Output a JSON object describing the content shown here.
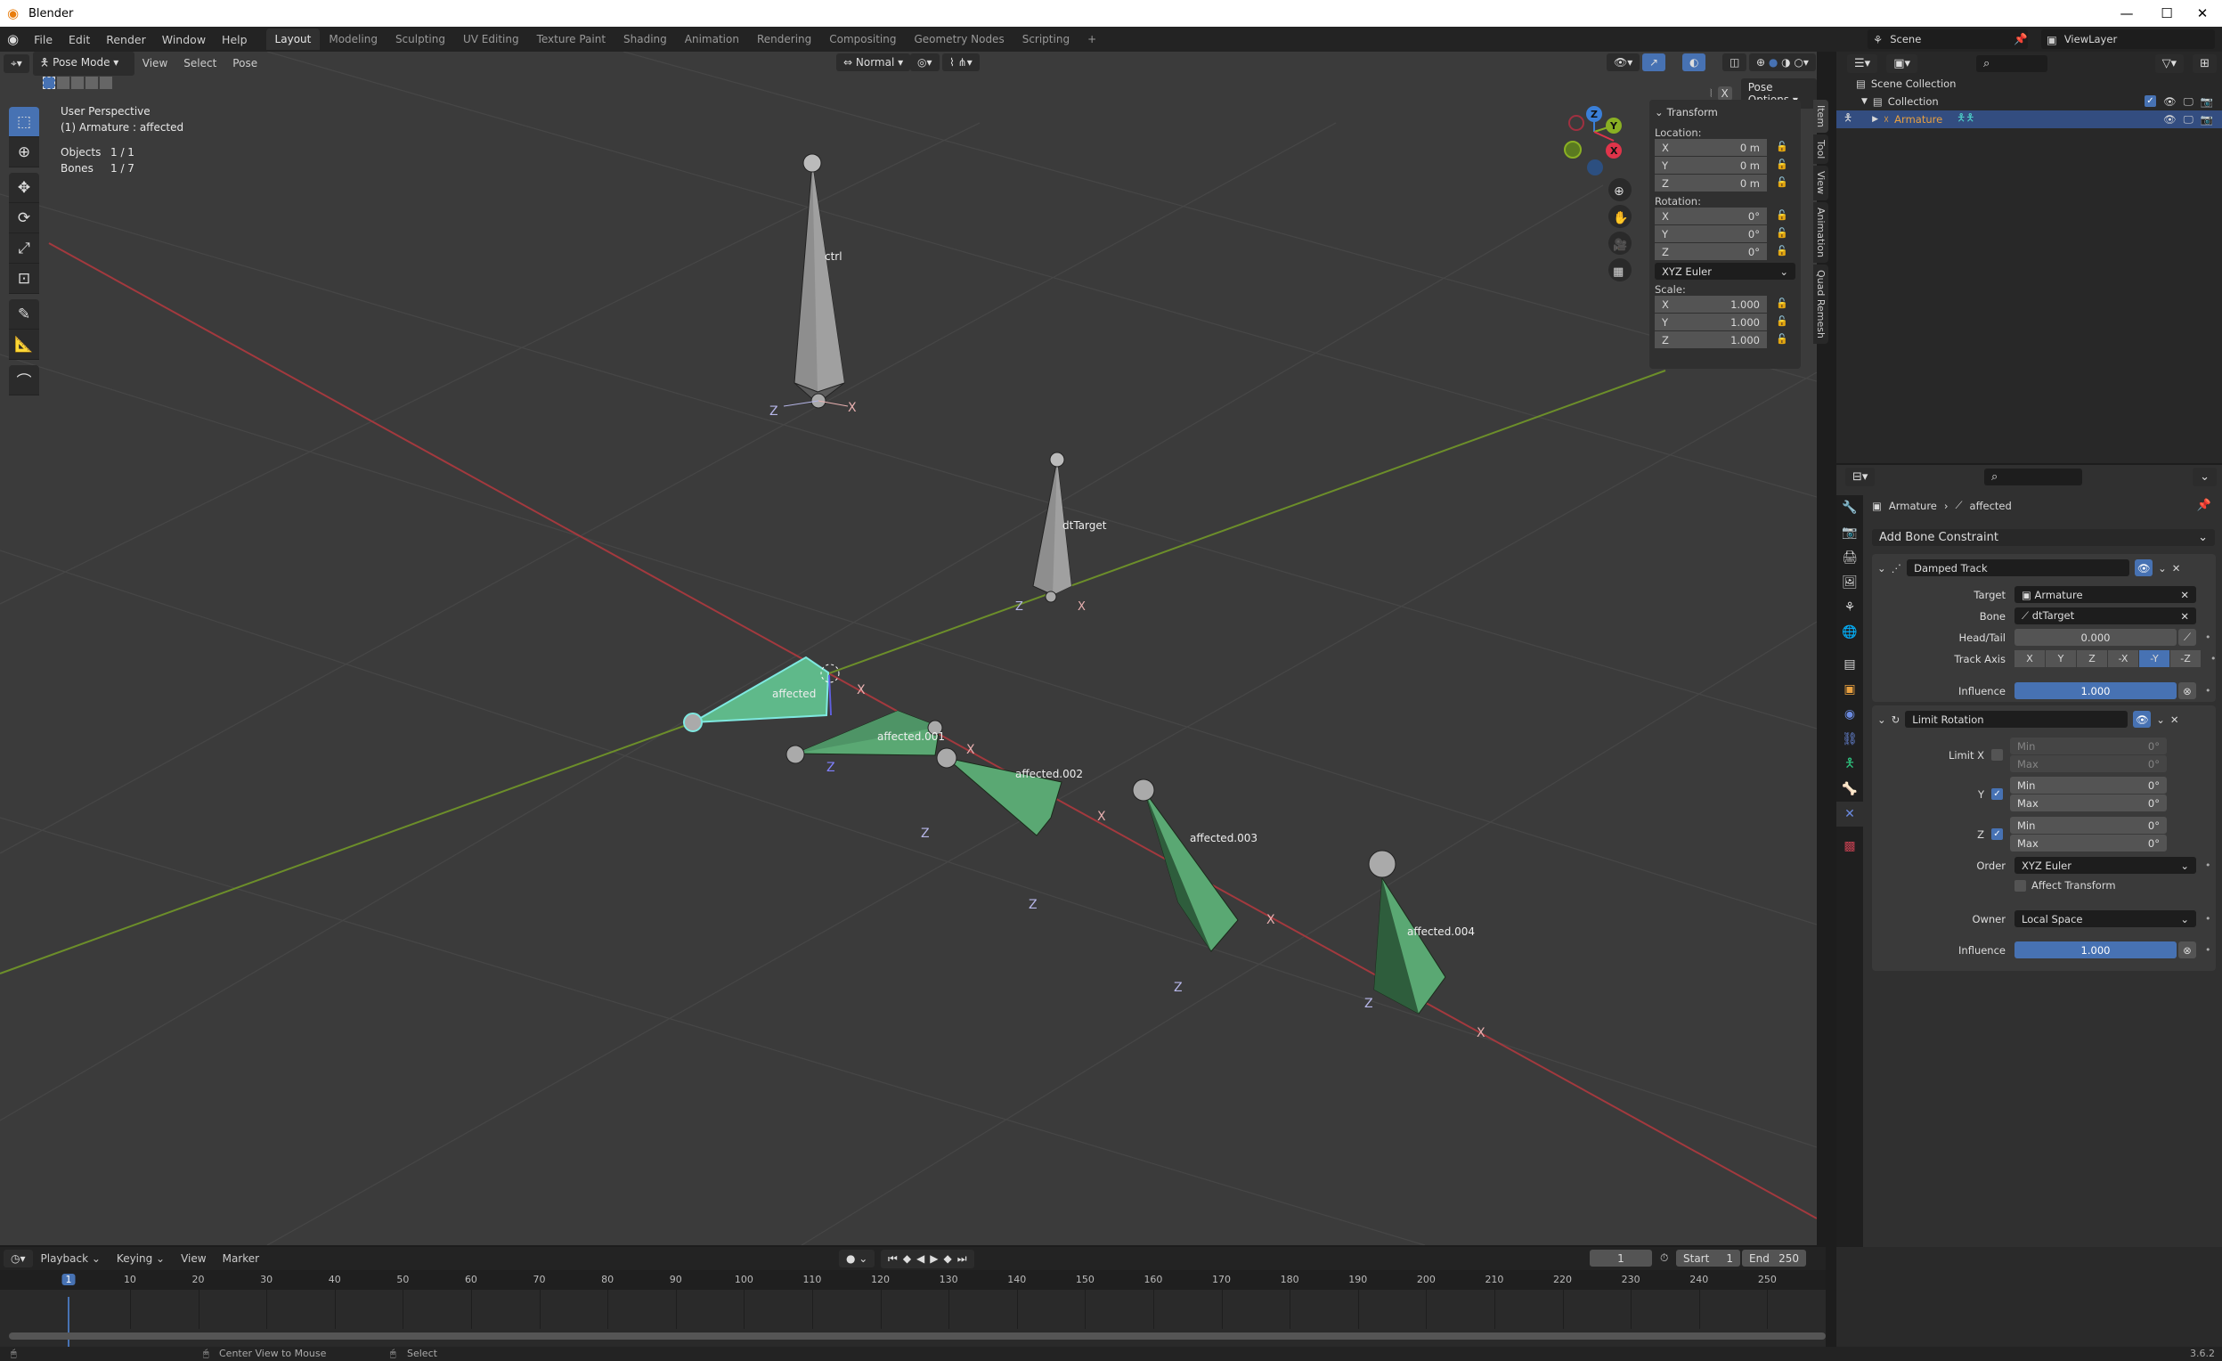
{
  "window": {
    "title": "Blender",
    "controls": [
      "—",
      "☐",
      "✕"
    ]
  },
  "menubar": {
    "menus": [
      "File",
      "Edit",
      "Render",
      "Window",
      "Help"
    ],
    "workspaces": [
      "Layout",
      "Modeling",
      "Sculpting",
      "UV Editing",
      "Texture Paint",
      "Shading",
      "Animation",
      "Rendering",
      "Compositing",
      "Geometry Nodes",
      "Scripting"
    ],
    "active_workspace": "Layout",
    "add_workspace": "+",
    "scene": "Scene",
    "view_layer": "ViewLayer"
  },
  "viewport": {
    "mode": "Pose Mode",
    "menus": [
      "View",
      "Select",
      "Pose"
    ],
    "orientation": "Normal",
    "pose_options": "Pose Options",
    "info": {
      "perspective": "User Perspective",
      "active": "(1) Armature : affected",
      "objects_label": "Objects",
      "objects_value": "1 / 1",
      "bones_label": "Bones",
      "bones_value": "1 / 7"
    },
    "bones": [
      {
        "name": "ctrl",
        "color": "#8c8c8c"
      },
      {
        "name": "dtTarget",
        "color": "#8c8c8c"
      },
      {
        "name": "affected",
        "color": "#5fb98a",
        "selected": true
      },
      {
        "name": "affected.001",
        "color": "#5aa873"
      },
      {
        "name": "affected.002",
        "color": "#5aa873"
      },
      {
        "name": "affected.003",
        "color": "#5aa873"
      },
      {
        "name": "affected.004",
        "color": "#5aa873"
      }
    ],
    "axis_labels": {
      "x": "X",
      "y": "Y",
      "z": "Z"
    },
    "gizmo": {
      "x": "X",
      "y": "Y",
      "z": "Z"
    }
  },
  "npanel": {
    "title": "Transform",
    "location_label": "Location:",
    "location": [
      {
        "axis": "X",
        "value": "0 m"
      },
      {
        "axis": "Y",
        "value": "0 m"
      },
      {
        "axis": "Z",
        "value": "0 m"
      }
    ],
    "rotation_label": "Rotation:",
    "rotation": [
      {
        "axis": "X",
        "value": "0°"
      },
      {
        "axis": "Y",
        "value": "0°"
      },
      {
        "axis": "Z",
        "value": "0°"
      }
    ],
    "rotation_mode": "XYZ Euler",
    "scale_label": "Scale:",
    "scale": [
      {
        "axis": "X",
        "value": "1.000"
      },
      {
        "axis": "Y",
        "value": "1.000"
      },
      {
        "axis": "Z",
        "value": "1.000"
      }
    ],
    "tabs": [
      "Item",
      "Tool",
      "View",
      "Animation",
      "Quad Remesh"
    ]
  },
  "outliner": {
    "scene_collection": "Scene Collection",
    "collection": "Collection",
    "armature": "Armature"
  },
  "properties": {
    "breadcrumb_object": "Armature",
    "breadcrumb_bone": "affected",
    "add_constraint": "Add Bone Constraint",
    "damped_track": {
      "name": "Damped Track",
      "target_label": "Target",
      "target": "Armature",
      "bone_label": "Bone",
      "bone": "dtTarget",
      "headtail_label": "Head/Tail",
      "headtail": "0.000",
      "track_axis_label": "Track Axis",
      "track_axes": [
        "X",
        "Y",
        "Z",
        "-X",
        "-Y",
        "-Z"
      ],
      "track_axis_active": "-Y",
      "influence_label": "Influence",
      "influence": "1.000"
    },
    "limit_rotation": {
      "name": "Limit Rotation",
      "limit_x_label": "Limit X",
      "limit_x": false,
      "y_label": "Y",
      "limit_y": true,
      "z_label": "Z",
      "limit_z": true,
      "min_label": "Min",
      "max_label": "Max",
      "x_min": "0°",
      "x_max": "0°",
      "y_min": "0°",
      "y_max": "0°",
      "z_min": "0°",
      "z_max": "0°",
      "order_label": "Order",
      "order": "XYZ Euler",
      "affect_transform": "Affect Transform",
      "owner_label": "Owner",
      "owner": "Local Space",
      "influence_label": "Influence",
      "influence": "1.000"
    }
  },
  "timeline": {
    "menus": [
      "Playback",
      "Keying",
      "View",
      "Marker"
    ],
    "current_frame": "1",
    "start_label": "Start",
    "start": "1",
    "end_label": "End",
    "end": "250",
    "ticks": [
      "1",
      "10",
      "20",
      "30",
      "40",
      "50",
      "60",
      "70",
      "80",
      "90",
      "100",
      "110",
      "120",
      "130",
      "140",
      "150",
      "160",
      "170",
      "180",
      "190",
      "200",
      "210",
      "220",
      "230",
      "240",
      "250"
    ]
  },
  "statusbar": {
    "hint1": "Center View to Mouse",
    "hint2": "Select",
    "version": "3.6.2"
  }
}
